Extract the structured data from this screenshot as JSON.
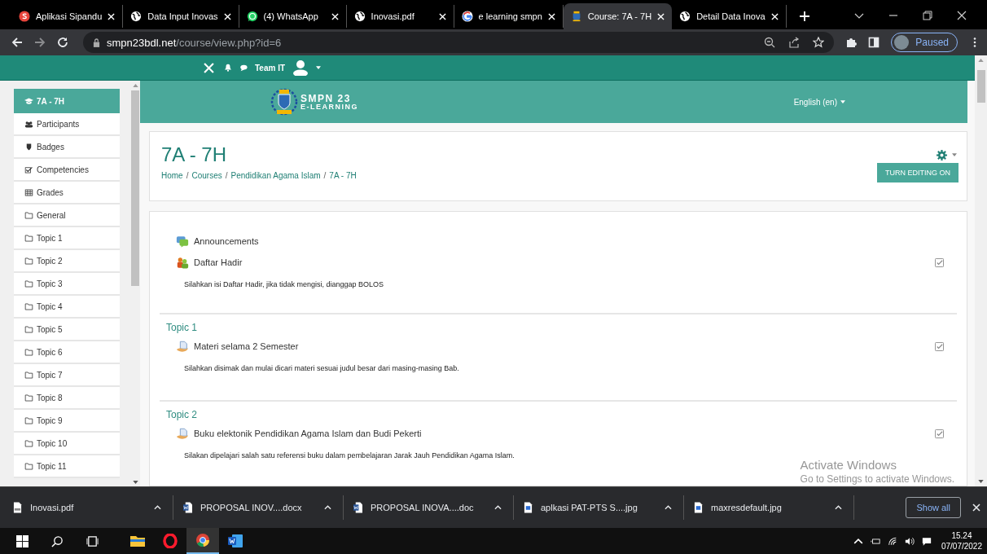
{
  "browser": {
    "tabs": [
      {
        "title": "Aplikasi Sipandu",
        "selected": false
      },
      {
        "title": "Data Input Inovas",
        "selected": false
      },
      {
        "title": "(4) WhatsApp",
        "selected": false
      },
      {
        "title": "Inovasi.pdf",
        "selected": false
      },
      {
        "title": "e learning smpn",
        "selected": false
      },
      {
        "title": "Course: 7A - 7H",
        "selected": true
      },
      {
        "title": "Detail Data Inova",
        "selected": false
      }
    ],
    "address": {
      "host": "smpn23bdl.net",
      "path": "/course/view.php?id=6"
    },
    "profile": {
      "label": "Paused"
    }
  },
  "navbar": {
    "user": "Team IT"
  },
  "header": {
    "logo_title": "SMPN 23",
    "logo_subtitle": "E-LEARNING",
    "language": "English (en)"
  },
  "sidebar": {
    "items": [
      {
        "label": "7A - 7H",
        "kind": "course",
        "selected": true
      },
      {
        "label": "Participants",
        "kind": "people",
        "selected": false
      },
      {
        "label": "Badges",
        "kind": "shield",
        "selected": false
      },
      {
        "label": "Competencies",
        "kind": "check",
        "selected": false
      },
      {
        "label": "Grades",
        "kind": "table",
        "selected": false
      },
      {
        "label": "General",
        "kind": "folder",
        "selected": false
      },
      {
        "label": "Topic 1",
        "kind": "folder",
        "selected": false
      },
      {
        "label": "Topic 2",
        "kind": "folder",
        "selected": false
      },
      {
        "label": "Topic 3",
        "kind": "folder",
        "selected": false
      },
      {
        "label": "Topic 4",
        "kind": "folder",
        "selected": false
      },
      {
        "label": "Topic 5",
        "kind": "folder",
        "selected": false
      },
      {
        "label": "Topic 6",
        "kind": "folder",
        "selected": false
      },
      {
        "label": "Topic 7",
        "kind": "folder",
        "selected": false
      },
      {
        "label": "Topic 8",
        "kind": "folder",
        "selected": false
      },
      {
        "label": "Topic 9",
        "kind": "folder",
        "selected": false
      },
      {
        "label": "Topic 10",
        "kind": "folder",
        "selected": false
      },
      {
        "label": "Topic 11",
        "kind": "folder",
        "selected": false
      }
    ]
  },
  "course": {
    "title": "7A - 7H",
    "breadcrumbs": [
      "Home",
      "Courses",
      "Pendidikan Agama Islam",
      "7A - 7H"
    ],
    "breadcrumb_separator": "/",
    "edit_button": "TURN EDITING ON"
  },
  "sections": [
    {
      "activities": [
        {
          "name": "Announcements",
          "kind": "forum",
          "completion_tracking": false
        },
        {
          "name": "Daftar Hadir",
          "kind": "attendance",
          "completion_tracking": true,
          "description": "Silahkan isi Daftar Hadir, jika tidak mengisi, dianggap BOLOS"
        }
      ]
    },
    {
      "title": "Topic 1",
      "activities": [
        {
          "name": "Materi selama 2 Semester",
          "kind": "resource",
          "completion_tracking": true,
          "description": "Silahkan disimak dan mulai dicari materi sesuai judul besar dari masing-masing Bab."
        }
      ]
    },
    {
      "title": "Topic 2",
      "activities": [
        {
          "name": "Buku elektonik Pendidikan Agama Islam dan Budi Pekerti",
          "kind": "resource",
          "completion_tracking": true,
          "description": "Silakan dipelajari salah satu referensi buku dalam pembelajaran Jarak Jauh Pendidikan Agama Islam."
        }
      ]
    }
  ],
  "activation_notice": {
    "title": "Activate Windows",
    "message": "Go to Settings to activate Windows."
  },
  "downloads": {
    "items": [
      {
        "name": "Inovasi.pdf",
        "kind": "pdf"
      },
      {
        "name": "PROPOSAL INOV....docx",
        "kind": "word"
      },
      {
        "name": "PROPOSAL INOVA....doc",
        "kind": "word"
      },
      {
        "name": "aplkasi PAT-PTS S....jpg",
        "kind": "image"
      },
      {
        "name": "maxresdefault.jpg",
        "kind": "image"
      }
    ],
    "show_all": "Show all"
  },
  "taskbar": {
    "apps": [
      {
        "kind": "explorer",
        "active": false
      },
      {
        "kind": "opera",
        "active": false
      },
      {
        "kind": "chrome",
        "active": true
      },
      {
        "kind": "word",
        "active": false
      }
    ],
    "time": "15.24",
    "date": "07/07/2022"
  }
}
